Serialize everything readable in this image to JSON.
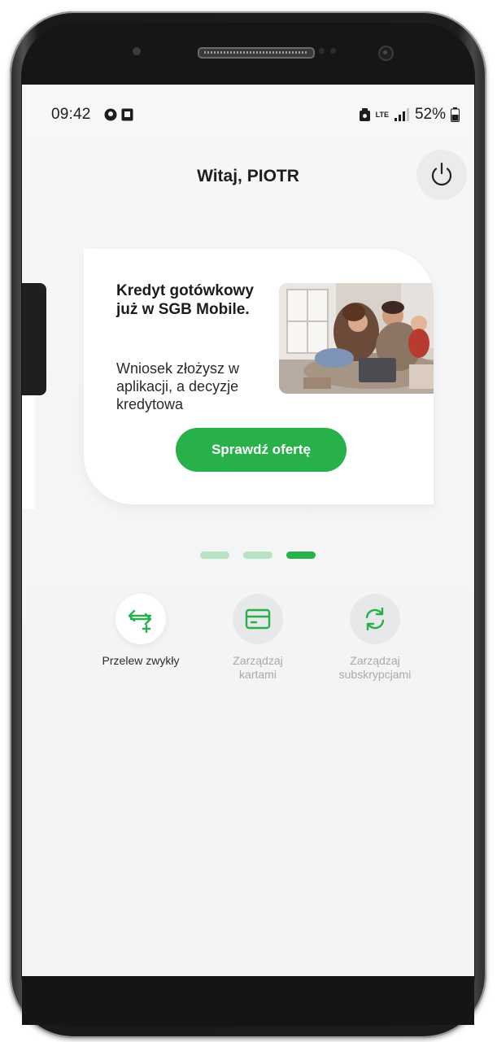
{
  "statusbar": {
    "time": "09:42",
    "network": "LTE",
    "battery": "52%"
  },
  "header": {
    "greeting": "Witaj, PIOTR",
    "power_icon": "power-icon"
  },
  "promo": {
    "title": "Kredyt gotówkowy już w SGB Mobile.",
    "description": "Wniosek złożysz w aplikacji, a decyzje kredytowa",
    "cta": "Sprawdź ofertę",
    "image": "family-on-couch-photo"
  },
  "carousel": {
    "page_count": 3,
    "active_page": 3
  },
  "quick_actions": [
    {
      "label": "Przelew zwykły",
      "icon": "transfer-icon",
      "enabled": true
    },
    {
      "label": "Zarządzaj kartami",
      "icon": "card-icon",
      "enabled": false
    },
    {
      "label": "Zarządzaj subskrypcjami",
      "icon": "refresh-icon",
      "enabled": false
    }
  ],
  "colors": {
    "accent": "#28b04a",
    "accent_light": "#b8e3c2",
    "background": "#f4f5f6"
  }
}
